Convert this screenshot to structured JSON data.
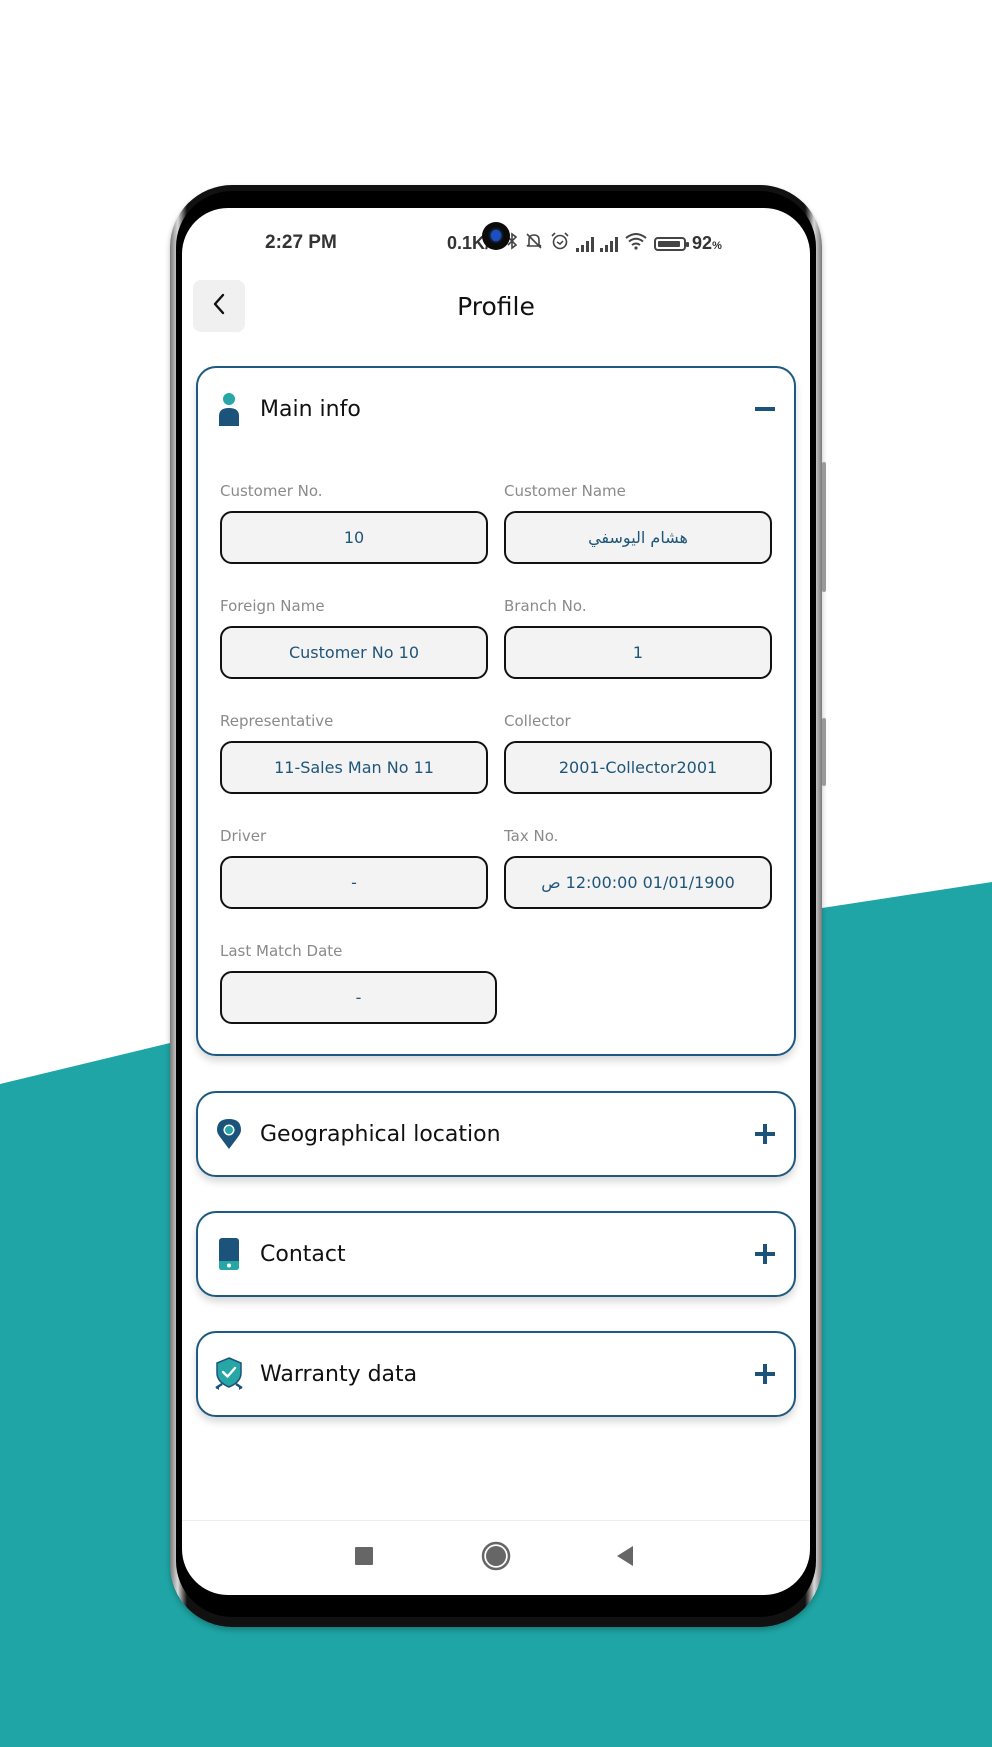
{
  "colors": {
    "teal_background": "#1fa5a5",
    "primary": "#1e5a80",
    "accent": "#26a7a5",
    "value_text": "#1f5578"
  },
  "status_bar": {
    "time": "2:27 PM",
    "network_speed": "0.1K/s",
    "battery_percent": "92",
    "battery_level": 0.92,
    "icons": [
      "bluetooth-icon",
      "mute-bell-icon",
      "alarm-icon",
      "signal-icon",
      "signal-icon",
      "wifi-icon",
      "battery-icon"
    ]
  },
  "header": {
    "back_icon": "chevron-left-icon",
    "title": "Profile"
  },
  "sections": {
    "main_info": {
      "title": "Main info",
      "icon": "person-icon",
      "state": "expanded",
      "toggle_icon": "minus-icon",
      "fields": [
        {
          "label": "Customer No.",
          "value": "10"
        },
        {
          "label": "Customer Name",
          "value": "هشام اليوسفي"
        },
        {
          "label": "Foreign Name",
          "value": "Customer No 10"
        },
        {
          "label": "Branch No.",
          "value": "1"
        },
        {
          "label": "Representative",
          "value": "11-Sales Man No 11"
        },
        {
          "label": "Collector",
          "value": "2001-Collector2001"
        },
        {
          "label": "Driver",
          "value": "-"
        },
        {
          "label": "Tax No.",
          "value": "01/01/1900 12:00:00 ص"
        },
        {
          "label": "Last Match Date",
          "value": "-"
        }
      ]
    },
    "geo": {
      "title": "Geographical location",
      "icon": "location-pin-icon",
      "state": "collapsed",
      "toggle_icon": "plus-icon"
    },
    "contact": {
      "title": "Contact",
      "icon": "phone-icon",
      "state": "collapsed",
      "toggle_icon": "plus-icon"
    },
    "warranty": {
      "title": "Warranty data",
      "icon": "shield-check-icon",
      "state": "collapsed",
      "toggle_icon": "plus-icon"
    }
  },
  "nav_bar": {
    "buttons": [
      "recents-square-icon",
      "home-circle-icon",
      "back-triangle-icon"
    ]
  }
}
